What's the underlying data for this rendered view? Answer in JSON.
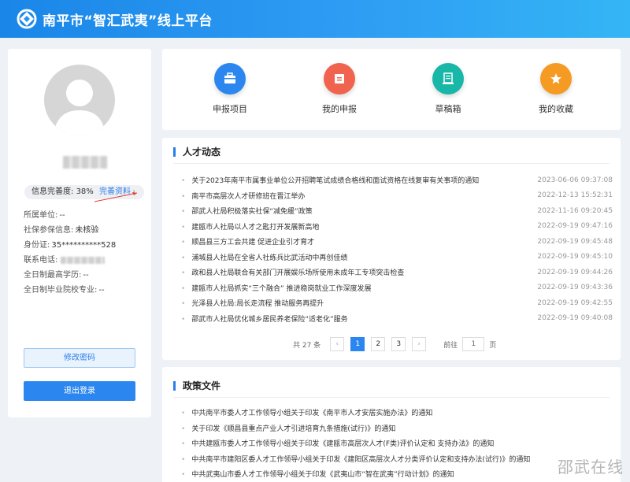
{
  "header": {
    "title": "南平市“智汇武夷”线上平台"
  },
  "profile": {
    "completion_label": "信息完善度:",
    "completion_value": "38%",
    "complete_link": "完善资料",
    "fields": [
      {
        "label": "所属单位:",
        "value": "--"
      },
      {
        "label": "社保参保信息:",
        "value": "未核验"
      },
      {
        "label": "身份证:",
        "value": "35**********528"
      },
      {
        "label": "联系电话:",
        "value": ""
      },
      {
        "label": "全日制最高学历:",
        "value": "--"
      },
      {
        "label": "全日制毕业院校专业:",
        "value": "--"
      }
    ],
    "change_password": "修改密码",
    "logout": "退出登录"
  },
  "quick_actions": [
    {
      "label": "申报项目",
      "icon": "briefcase-icon",
      "color": "#2b86ef"
    },
    {
      "label": "我的申报",
      "icon": "folder-icon",
      "color": "#f0634f"
    },
    {
      "label": "草稿箱",
      "icon": "document-icon",
      "color": "#18b7a8"
    },
    {
      "label": "我的收藏",
      "icon": "star-icon",
      "color": "#f59a23"
    }
  ],
  "news": {
    "title": "人才动态",
    "items": [
      {
        "title": "关于2023年南平市属事业单位公开招聘笔试成绩合格线和面试资格在线复审有关事项的通知",
        "date": "2023-06-06 09:37:08"
      },
      {
        "title": "南平市高层次人才研修班在晋江举办",
        "date": "2022-12-13 15:52:31"
      },
      {
        "title": "邵武人社局积极落实社保“减免缓”政策",
        "date": "2022-11-16 09:20:45"
      },
      {
        "title": "建瓯市人社局以人才之匙打开发展新高地",
        "date": "2022-09-19 09:47:16"
      },
      {
        "title": "顺昌县三方工会共建 促进企业引才育才",
        "date": "2022-09-19 09:45:48"
      },
      {
        "title": "浦城县人社局在全省人社练兵比武活动中再创佳绩",
        "date": "2022-09-19 09:45:10"
      },
      {
        "title": "政和县人社局联合有关部门开展娱乐场所使用未成年工专项突击检查",
        "date": "2022-09-19 09:44:26"
      },
      {
        "title": "建瓯市人社局抓实“三个融合” 推进稳岗就业工作深度发展",
        "date": "2022-09-19 09:43:36"
      },
      {
        "title": "光泽县人社局:局长走流程 推动服务再提升",
        "date": "2022-09-19 09:42:55"
      },
      {
        "title": "邵武市人社局优化城乡居民养老保险“适老化”服务",
        "date": "2022-09-19 09:40:08"
      }
    ],
    "pager": {
      "total": "共 27 条",
      "pages": [
        "1",
        "2",
        "3"
      ],
      "goto_label": "前往",
      "goto_value": "1",
      "page_unit": "页"
    }
  },
  "policy": {
    "title": "政策文件",
    "items": [
      "中共南平市委人才工作领导小组关于印发《南平市人才安居实施办法》的通知",
      "关于印发《顺昌县重点产业人才引进培育九条措施(试行)》的通知",
      "中共建瓯市委人才工作领导小组关于印发《建瓯市高层次人才(F类)评价认定和 支持办法》的通知",
      "中共南平市建阳区委人才工作领导小组关于印发《建阳区高层次人才分类评价认定和支持办法(试行)》的通知",
      "中共武夷山市委人才工作领导小组关于印发《武夷山市“智在武夷”行动计划》的通知"
    ]
  },
  "watermark": "邵武在线"
}
